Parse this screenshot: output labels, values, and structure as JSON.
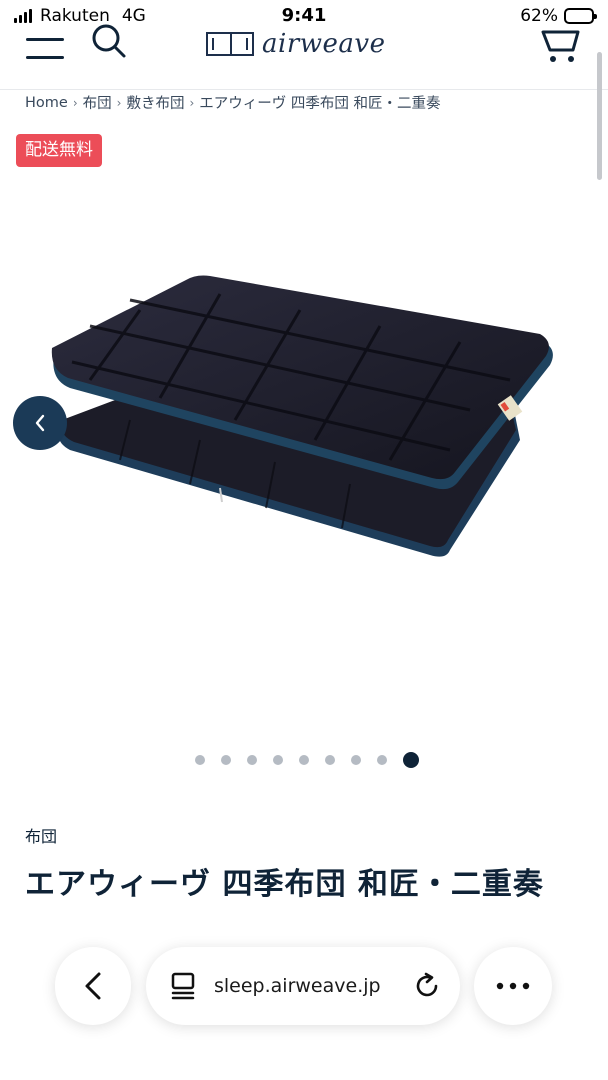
{
  "status_bar": {
    "carrier": "Rakuten",
    "network": "4G",
    "time": "9:41",
    "battery_percent": "62%",
    "battery_level": 0.62
  },
  "header": {
    "logo_text": "airweave",
    "menu_icon": "hamburger-menu-icon",
    "search_icon": "search-icon",
    "cart_icon": "cart-icon"
  },
  "breadcrumb": [
    "Home",
    "布団",
    "敷き布団",
    "エアウィーヴ 四季布団 和匠・二重奏"
  ],
  "badge": {
    "label": "配送無料",
    "color": "#ec4d58"
  },
  "carousel": {
    "total": 9,
    "active_index": 9,
    "prev_icon": "chevron-left-icon"
  },
  "product": {
    "category": "布団",
    "title": "エアウィーヴ 四季布団 和匠・二重奏"
  },
  "browser": {
    "url": "sleep.airweave.jp",
    "back_icon": "chevron-left-icon",
    "tabs_icon": "tabs-icon",
    "reload_icon": "reload-icon",
    "more_icon": "more-icon"
  },
  "colors": {
    "navy": "#0f2337",
    "accent_button": "#1b3a57",
    "badge_red": "#ec4d58"
  }
}
